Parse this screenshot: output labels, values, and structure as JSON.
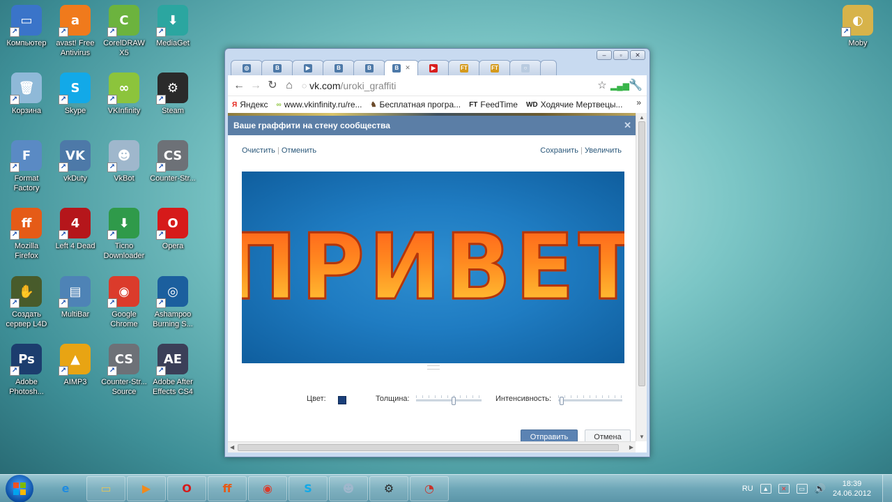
{
  "desktop_icons": [
    {
      "label": "Компьютер",
      "glyph": "▭",
      "color": "#3a74c9",
      "icon": "computer-icon"
    },
    {
      "label": "avast! Free Antivirus",
      "glyph": "a",
      "color": "#f07a1c",
      "icon": "avast-icon"
    },
    {
      "label": "CorelDRAW X5",
      "glyph": "C",
      "color": "#6cb33e",
      "icon": "coreldraw-icon"
    },
    {
      "label": "MediaGet",
      "glyph": "⬇",
      "color": "#2ba6a0",
      "icon": "mediaget-icon"
    },
    {
      "label": "Корзина",
      "glyph": "🗑",
      "color": "#8fb9d8",
      "icon": "recycle-bin-icon"
    },
    {
      "label": "Skype",
      "glyph": "S",
      "color": "#12a9e8",
      "icon": "skype-icon"
    },
    {
      "label": "VKInfinity",
      "glyph": "∞",
      "color": "#8cc43c",
      "icon": "vkinfinity-icon"
    },
    {
      "label": "Steam",
      "glyph": "⚙",
      "color": "#2a2a2a",
      "icon": "steam-icon"
    },
    {
      "label": "Format Factory",
      "glyph": "F",
      "color": "#5a8ac4",
      "icon": "format-factory-icon"
    },
    {
      "label": "vkDuty",
      "glyph": "VK",
      "color": "#4d79a8",
      "icon": "vkduty-icon"
    },
    {
      "label": "VkBot",
      "glyph": "☻",
      "color": "#9fb7cc",
      "icon": "vkbot-icon"
    },
    {
      "label": "Counter-Str...",
      "glyph": "CS",
      "color": "#6d7177",
      "icon": "counter-strike-icon"
    },
    {
      "label": "Mozilla Firefox",
      "glyph": "ff",
      "color": "#e55b17",
      "icon": "firefox-icon"
    },
    {
      "label": "Left 4 Dead",
      "glyph": "4",
      "color": "#b5161b",
      "icon": "left4dead-icon"
    },
    {
      "label": "Ticno Downloader",
      "glyph": "⬇",
      "color": "#2f9a4a",
      "icon": "ticno-downloader-icon"
    },
    {
      "label": "Opera",
      "glyph": "O",
      "color": "#d61a1a",
      "icon": "opera-icon"
    },
    {
      "label": "Создать сервер L4D",
      "glyph": "✋",
      "color": "#485b2b",
      "icon": "l4d-server-icon"
    },
    {
      "label": "MultiBar",
      "glyph": "▤",
      "color": "#4e83b6",
      "icon": "multibar-icon"
    },
    {
      "label": "Google Chrome",
      "glyph": "◉",
      "color": "#db3b2b",
      "icon": "chrome-icon"
    },
    {
      "label": "Ashampoo Burning S...",
      "glyph": "◎",
      "color": "#1b5f9e",
      "icon": "ashampoo-icon"
    },
    {
      "label": "Adobe Photosh...",
      "glyph": "Ps",
      "color": "#1c3d6e",
      "icon": "photoshop-icon"
    },
    {
      "label": "AIMP3",
      "glyph": "▲",
      "color": "#e8a413",
      "icon": "aimp-icon"
    },
    {
      "label": "Counter-Str... Source",
      "glyph": "CS",
      "color": "#6d7177",
      "icon": "cs-source-icon"
    },
    {
      "label": "Adobe After Effects CS4",
      "glyph": "AE",
      "color": "#3b3f58",
      "icon": "after-effects-icon"
    },
    {
      "label": "Moby",
      "glyph": "◐",
      "color": "#d7b34a",
      "icon": "moby-icon"
    }
  ],
  "browser": {
    "tabs": [
      {
        "favicon": "◎",
        "color": "#4d79a8",
        "icon": "chrome-tab-icon"
      },
      {
        "favicon": "B",
        "color": "#4d79a8",
        "icon": "vk-tab-icon"
      },
      {
        "favicon": "▶",
        "color": "#4d79a8",
        "icon": "video-tab-icon"
      },
      {
        "favicon": "B",
        "color": "#4d79a8",
        "icon": "vk-tab-icon"
      },
      {
        "favicon": "B",
        "color": "#4d79a8",
        "icon": "vk-tab-icon"
      },
      {
        "favicon": "B",
        "color": "#4d79a8",
        "icon": "vk-tab-icon",
        "active": true
      },
      {
        "favicon": "▶",
        "color": "#d81e1e",
        "icon": "youtube-tab-icon"
      },
      {
        "favicon": "FT",
        "color": "#d59a1c",
        "icon": "feedtime-tab-icon"
      },
      {
        "favicon": "FT",
        "color": "#d59a1c",
        "icon": "feedtime-tab-icon"
      },
      {
        "favicon": "○",
        "color": "#b9cbe0",
        "icon": "blank-tab-icon"
      }
    ],
    "address": {
      "host": "vk.com",
      "path": "/uroki_graffiti"
    },
    "bookmarks": [
      {
        "label": "Яндекс",
        "glyph": "Я",
        "color": "#e5231b",
        "icon": "yandex-icon"
      },
      {
        "label": "www.vkinfinity.ru/re...",
        "glyph": "∞",
        "color": "#8cc43c",
        "icon": "vkinfinity-icon"
      },
      {
        "label": "Бесплатная програ...",
        "glyph": "♞",
        "color": "#6b4a2a",
        "icon": "program-icon"
      },
      {
        "label": "FeedTime",
        "glyph": "FT",
        "color": "#222",
        "icon": "feedtime-icon"
      },
      {
        "label": "Ходячие Мертвецы...",
        "glyph": "WD",
        "color": "#222",
        "icon": "walking-dead-icon"
      }
    ]
  },
  "dialog": {
    "title": "Ваше граффити на стену сообщества",
    "clear": "Очистить",
    "undo": "Отменить",
    "save": "Сохранить",
    "zoom": "Увеличить",
    "graffiti_text": "ПРИВЕТ",
    "color_label": "Цвет:",
    "color_value": "#1a3f7a",
    "thickness_label": "Толщина:",
    "thickness_level": 0.58,
    "intensity_label": "Интенсивность:",
    "intensity_level": 0.02,
    "send": "Отправить",
    "cancel": "Отмена"
  },
  "taskbar": {
    "items": [
      {
        "glyph": "e",
        "color": "#1f8be0",
        "icon": "ie-icon"
      },
      {
        "glyph": "▭",
        "color": "#e2c45a",
        "icon": "explorer-icon"
      },
      {
        "glyph": "▶",
        "color": "#f08a1c",
        "icon": "media-player-icon"
      },
      {
        "glyph": "O",
        "color": "#d61a1a",
        "icon": "opera-icon"
      },
      {
        "glyph": "ff",
        "color": "#e55b17",
        "icon": "firefox-icon"
      },
      {
        "glyph": "◉",
        "color": "#db3b2b",
        "icon": "chrome-icon"
      },
      {
        "glyph": "S",
        "color": "#12a9e8",
        "icon": "skype-icon"
      },
      {
        "glyph": "☻",
        "color": "#9fb7cc",
        "icon": "vkbot-icon"
      },
      {
        "glyph": "⚙",
        "color": "#2a2a2a",
        "icon": "steam-icon"
      },
      {
        "glyph": "◔",
        "color": "#c8332b",
        "icon": "app-icon"
      }
    ],
    "lang": "RU",
    "time": "18:39",
    "date": "24.06.2012"
  }
}
